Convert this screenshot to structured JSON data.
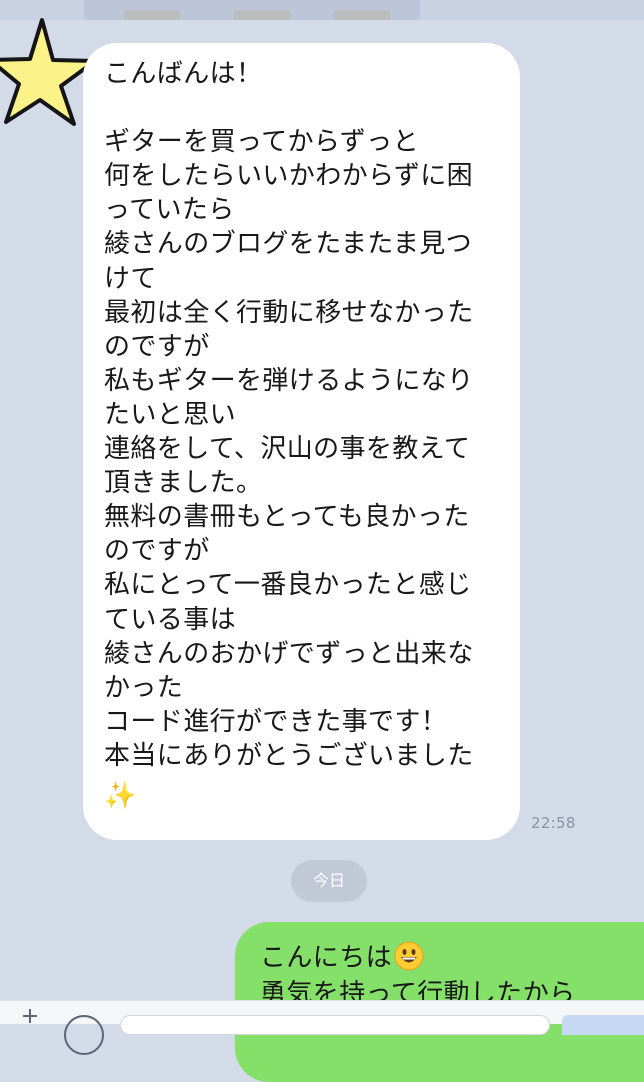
{
  "colors": {
    "background": "#d3dbe8",
    "incoming_bubble": "#ffffff",
    "outgoing_bubble": "#84e069",
    "timestamp": "#8a93a3",
    "date_pill": "#c2c9d6"
  },
  "incoming_message": {
    "avatar_icon": "star-icon",
    "lines": [
      "こんばんは！",
      "",
      "ギターを買ってからずっと",
      "何をしたらいいかわからずに困",
      "っていたら",
      "綾さんのブログをたまたま見つ",
      "けて",
      "最初は全く行動に移せなかった",
      "のですが",
      "私もギターを弾けるようになり",
      "たいと思い",
      "連絡をして、沢山の事を教えて",
      "頂きました。",
      "無料の書冊もとっても良かった",
      "のですが",
      "私にとって一番良かったと感じ",
      "ている事は",
      "綾さんのおかげでずっと出来な",
      "かった",
      "コード進行ができた事です！",
      "本当にありがとうございました"
    ],
    "sparkle": "✨",
    "time": "22:58"
  },
  "date_separator": "今日",
  "outgoing_message": {
    "lines": [
      "こんにちは",
      "勇気を持って行動したから"
    ],
    "emoji_icon": "grinning-face-icon"
  },
  "input_bar": {
    "plus_icon": "plus-icon",
    "stamp_icon": "stamp-icon"
  }
}
